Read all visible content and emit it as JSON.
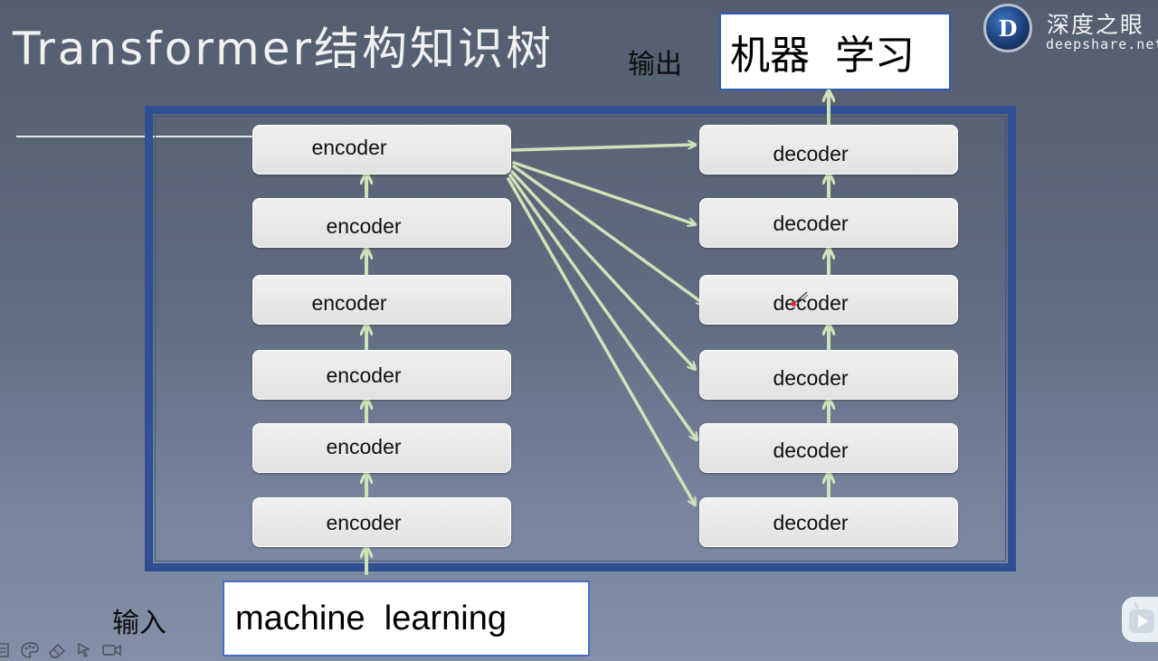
{
  "title": "Transformer结构知识树",
  "logo": {
    "icon_letter": "D",
    "name": "深度之眼",
    "site": "deepshare.net"
  },
  "output": {
    "label": "输出",
    "text": "机器  学习"
  },
  "input": {
    "label": "输入",
    "text": "machine  learning"
  },
  "encoders": [
    {
      "label": "encoder"
    },
    {
      "label": "encoder"
    },
    {
      "label": "encoder"
    },
    {
      "label": "encoder"
    },
    {
      "label": "encoder"
    },
    {
      "label": "encoder"
    }
  ],
  "decoders": [
    {
      "label": "decoder"
    },
    {
      "label": "decoder"
    },
    {
      "label": "decoder"
    },
    {
      "label": "decoder"
    },
    {
      "label": "decoder"
    },
    {
      "label": "decoder"
    }
  ],
  "colors": {
    "frame": "#2f4f92",
    "arrow": "#cfe3b9",
    "output_border": "#2c5ab8"
  },
  "toolbar": [
    "list-icon",
    "palette-icon",
    "eraser-icon",
    "pointer-icon",
    "video-icon"
  ]
}
